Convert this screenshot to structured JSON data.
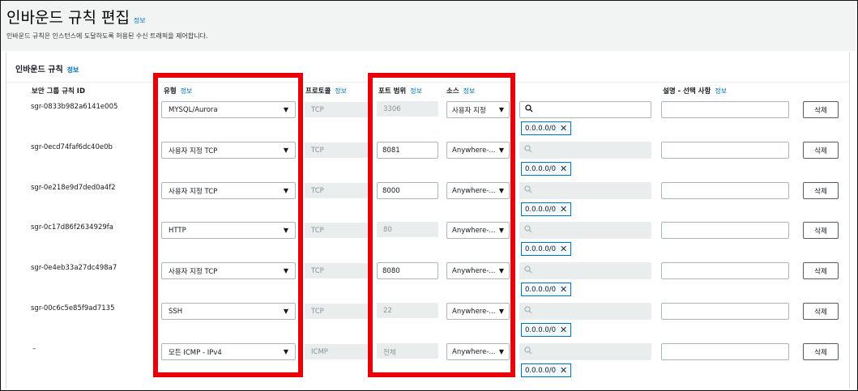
{
  "header": {
    "title": "인바운드 규칙 편집",
    "info": "정보",
    "description": "인바운드 규칙은 인스턴스에 도달하도록 허용된 수신 트래픽을 제어합니다."
  },
  "section": {
    "title": "인바운드 규칙",
    "info": "정보"
  },
  "columns": {
    "rule_id": "보안 그룹 규칙 ID",
    "type": "유형",
    "protocol": "프로토콜",
    "port_range": "포트 범위",
    "source": "소스",
    "description": "설명 - 선택 사항",
    "info": "정보"
  },
  "rules": [
    {
      "id": "sgr-0833b982a6141e005",
      "type": "MYSQL/Aurora",
      "protocol": "TCP",
      "port": "3306",
      "source": "사용자 지정",
      "cidr": "0.0.0.0/0",
      "delete": "삭제"
    },
    {
      "id": "sgr-0ecd74faf6dc40e0b",
      "type": "사용자 지정 TCP",
      "protocol": "TCP",
      "port": "8081",
      "source": "Anywhere-...",
      "cidr": "0.0.0.0/0",
      "delete": "삭제"
    },
    {
      "id": "sgr-0e218e9d7ded0a4f2",
      "type": "사용자 지정 TCP",
      "protocol": "TCP",
      "port": "8000",
      "source": "Anywhere-...",
      "cidr": "0.0.0.0/0",
      "delete": "삭제"
    },
    {
      "id": "sgr-0c17d86f2634929fa",
      "type": "HTTP",
      "protocol": "TCP",
      "port": "80",
      "source": "Anywhere-...",
      "cidr": "0.0.0.0/0",
      "delete": "삭제"
    },
    {
      "id": "sgr-0e4eb33a27dc498a7",
      "type": "사용자 지정 TCP",
      "protocol": "TCP",
      "port": "8080",
      "source": "Anywhere-...",
      "cidr": "0.0.0.0/0",
      "delete": "삭제"
    },
    {
      "id": "sgr-00c6c5e85f9ad7135",
      "type": "SSH",
      "protocol": "TCP",
      "port": "22",
      "source": "Anywhere-...",
      "cidr": "0.0.0.0/0",
      "delete": "삭제"
    },
    {
      "id": "–",
      "type": "모든 ICMP - IPv4",
      "protocol": "ICMP",
      "port": "전체",
      "source": "Anywhere-...",
      "cidr": "0.0.0.0/0",
      "delete": "삭제"
    }
  ],
  "icons": {
    "caret": "caret-down-icon",
    "search": "search-icon",
    "remove": "close-icon"
  },
  "colors": {
    "link": "#0073bb",
    "highlight": "#e8000b",
    "header_bg": "#f2f3f3"
  }
}
